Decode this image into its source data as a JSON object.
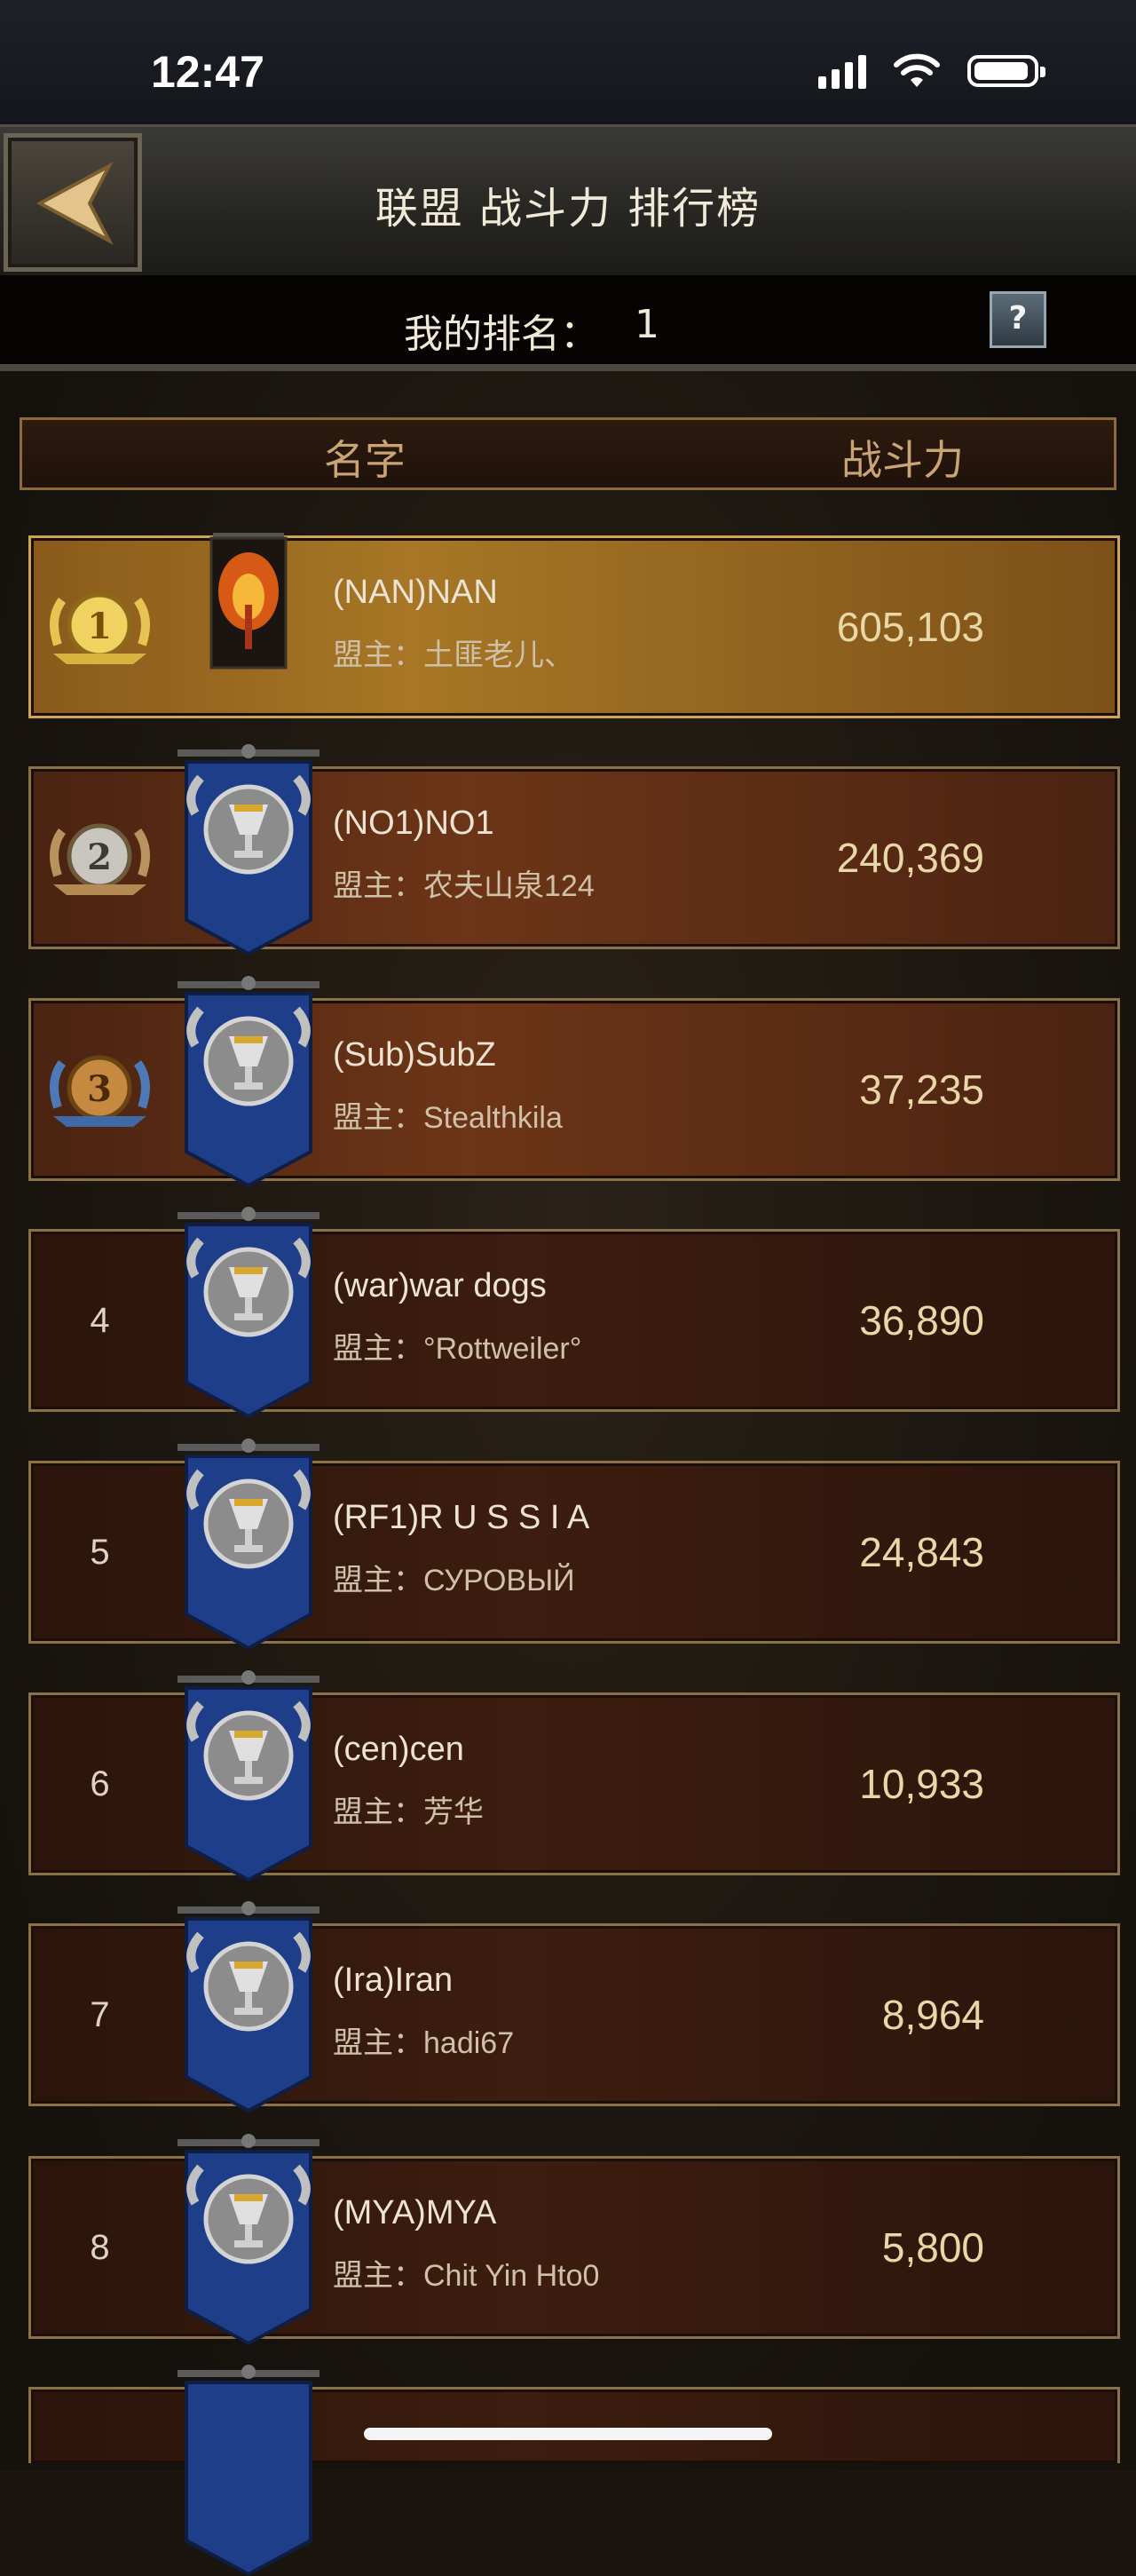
{
  "status_bar": {
    "time": "12:47"
  },
  "header": {
    "title": "联盟 战斗力 排行榜"
  },
  "my_rank": {
    "label": "我的排名：",
    "value": "1",
    "help": "?"
  },
  "columns": {
    "name": "名字",
    "power": "战斗力"
  },
  "rows": [
    {
      "rank": "1",
      "name": "(NAN)NAN",
      "leader_prefix": "盟主：",
      "leader": "土匪老儿、",
      "power": "605,103"
    },
    {
      "rank": "2",
      "name": "(NO1)NO1",
      "leader_prefix": "盟主：",
      "leader": "农夫山泉124",
      "power": "240,369"
    },
    {
      "rank": "3",
      "name": "(Sub)SubZ",
      "leader_prefix": "盟主：",
      "leader": "Stealthkila",
      "power": "37,235"
    },
    {
      "rank": "4",
      "name": "(war)war dogs",
      "leader_prefix": "盟主：",
      "leader": "°Rottweiler°",
      "power": "36,890"
    },
    {
      "rank": "5",
      "name": "(RF1)R U S S I A",
      "leader_prefix": "盟主：",
      "leader": "СУРОВЫЙ",
      "power": "24,843"
    },
    {
      "rank": "6",
      "name": "(cen)cen",
      "leader_prefix": "盟主：",
      "leader": "芳华",
      "power": "10,933"
    },
    {
      "rank": "7",
      "name": "(Ira)Iran",
      "leader_prefix": "盟主：",
      "leader": "hadi67",
      "power": "8,964"
    },
    {
      "rank": "8",
      "name": "(MYA)MYA",
      "leader_prefix": "盟主：",
      "leader": "Chit Yin Hto0",
      "power": "5,800"
    }
  ]
}
